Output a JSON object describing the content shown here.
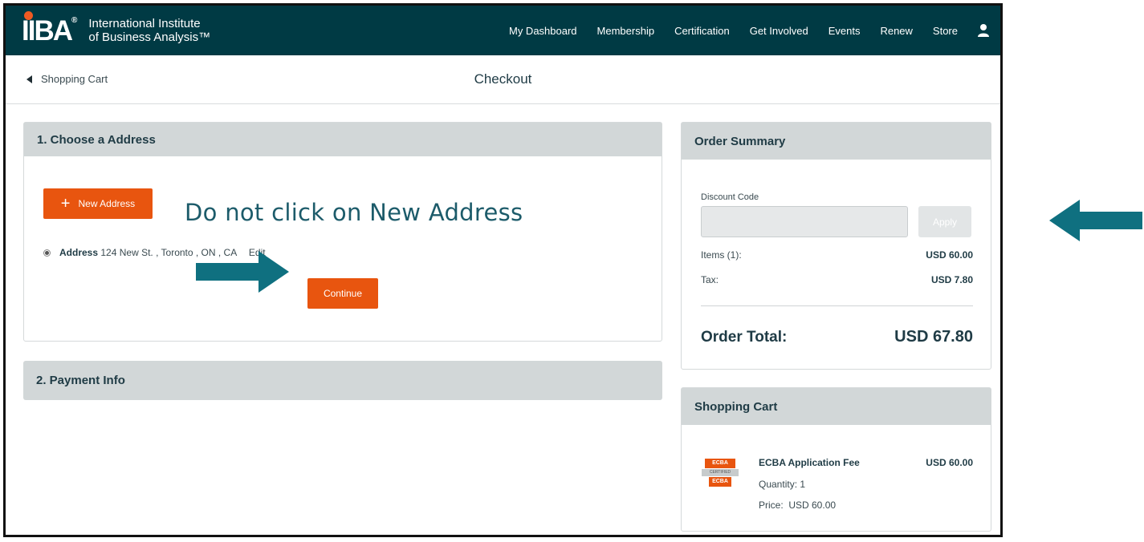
{
  "brand": {
    "logo_mark": "IIBA",
    "registered": "®",
    "name_line1": "International Institute",
    "name_line2": "of Business Analysis™"
  },
  "nav": {
    "items": [
      "My Dashboard",
      "Membership",
      "Certification",
      "Get Involved",
      "Events",
      "Renew",
      "Store"
    ],
    "user_icon": "user-icon"
  },
  "subheader": {
    "back_label": "Shopping Cart",
    "title": "Checkout"
  },
  "address_section": {
    "heading": "1. Choose a Address",
    "new_address_label": "New Address",
    "instruction": "Do not click on New Address",
    "address_label": "Address",
    "address_value": "124 New St. , Toronto , ON , CA",
    "edit_label": "Edit",
    "continue_label": "Continue"
  },
  "payment_section": {
    "heading": "2. Payment Info"
  },
  "order_summary": {
    "heading": "Order Summary",
    "discount_label": "Discount Code",
    "discount_value": "",
    "apply_label": "Apply",
    "items_label": "Items (1):",
    "items_value": "USD 60.00",
    "tax_label": "Tax:",
    "tax_value": "USD 7.80",
    "total_label": "Order Total:",
    "total_value": "USD 67.80"
  },
  "shopping_cart": {
    "heading": "Shopping Cart",
    "item_name": "ECBA Application Fee",
    "item_price": "USD 60.00",
    "quantity_text": "Quantity: 1",
    "price_text": "Price:  USD 60.00",
    "badge_top": "ECBA",
    "badge_mid": "CERTIFIED",
    "badge_bottom": "ECBA"
  },
  "colors": {
    "header_bg": "#003a44",
    "accent_orange": "#e8550f",
    "panel_head_bg": "#d2d7d8",
    "arrow_teal": "#0f7080"
  }
}
